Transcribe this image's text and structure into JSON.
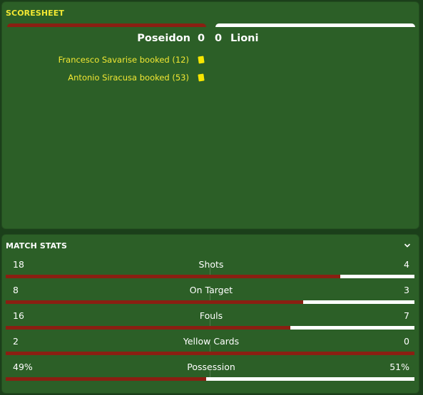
{
  "scoresheet": {
    "title": "SCORESHEET",
    "home_team": "Poseidon",
    "home_score": "0",
    "away_score": "0",
    "away_team": "Lioni",
    "home_color": "#8a1f12",
    "away_color": "#ffffff",
    "events": [
      {
        "text": "Francesco Savarise booked (12)",
        "icon": "yellow-card-icon"
      },
      {
        "text": "Antonio Siracusa booked (53)",
        "icon": "yellow-card-icon"
      }
    ]
  },
  "match_stats": {
    "title": "MATCH STATS",
    "collapse_icon": "chevron-down-icon",
    "stats": [
      {
        "label": "Shots",
        "home": "18",
        "away": "4",
        "home_share": 0.818
      },
      {
        "label": "On Target",
        "home": "8",
        "away": "3",
        "home_share": 0.727
      },
      {
        "label": "Fouls",
        "home": "16",
        "away": "7",
        "home_share": 0.696
      },
      {
        "label": "Yellow Cards",
        "home": "2",
        "away": "0",
        "home_share": 1.0
      },
      {
        "label": "Possession",
        "home": "49%",
        "away": "51%",
        "home_share": 0.49
      }
    ]
  }
}
